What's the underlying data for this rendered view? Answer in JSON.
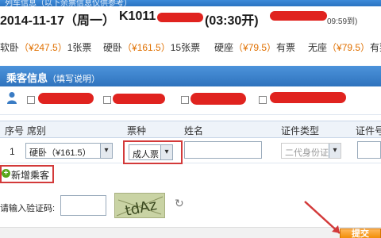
{
  "train": {
    "topbar_text": "列车信息（以下余票信息仅供参考）",
    "date": "2014-11-17（周一）",
    "train_no": "K1011",
    "depart_time": "(03:30开)",
    "arrive_time": "09:59到)",
    "seats": [
      {
        "type": "软卧",
        "price": "（¥247.5）",
        "avail": "1张票"
      },
      {
        "type": "硬卧",
        "price": "（¥161.5）",
        "avail": "15张票"
      },
      {
        "type": "硬座",
        "price": "（¥79.5）",
        "avail": "有票"
      },
      {
        "type": "无座",
        "price": "（¥79.5）",
        "avail": "有票"
      }
    ]
  },
  "passenger_section": {
    "title": "乘客信息",
    "hint": "（填写说明）"
  },
  "table": {
    "headers": [
      "序号",
      "席别",
      "票种",
      "姓名",
      "证件类型",
      "证件号"
    ],
    "row": {
      "no": "1",
      "seat": "硬卧（¥161.5）",
      "ticket_type": "成人票",
      "id_type": "二代身份证"
    }
  },
  "add_passenger": "新增乘客",
  "captcha": {
    "label": "请输入验证码:",
    "code": "tdAz"
  },
  "submit": "提交",
  "colors": {
    "header_blue": "#2f73bd",
    "price_orange": "#e07000",
    "annotation_red": "#d33a3a",
    "submit_orange": "#f18a00"
  }
}
